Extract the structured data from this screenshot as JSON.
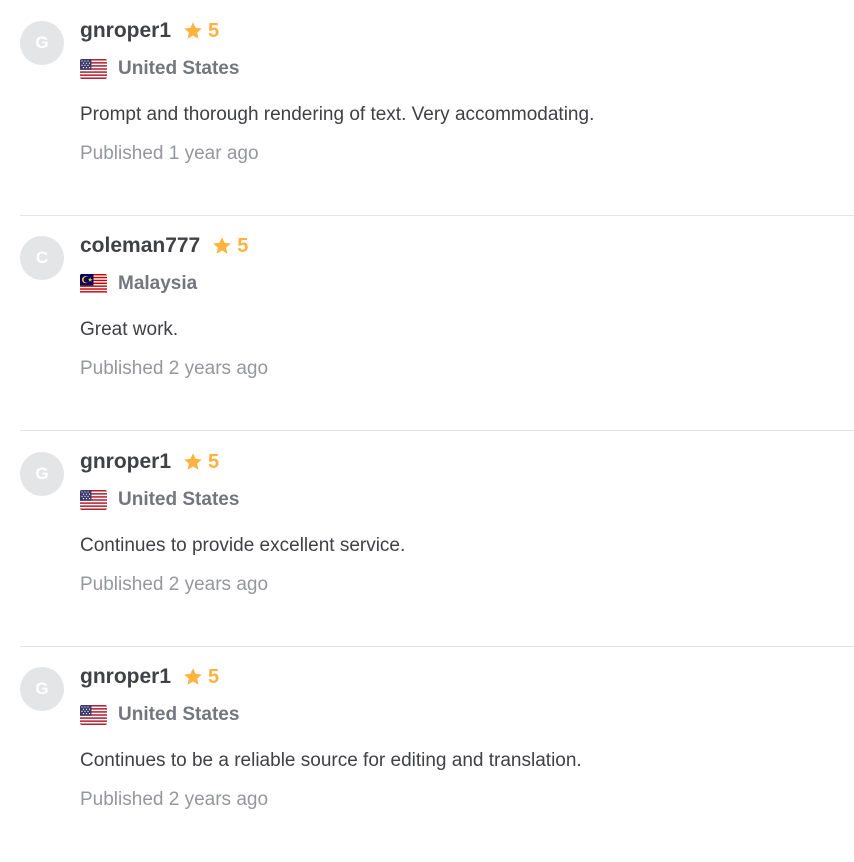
{
  "reviews": [
    {
      "avatar_letter": "G",
      "username": "gnroper1",
      "rating": "5",
      "flag": "us-flag-icon",
      "country": "United States",
      "text": "Prompt and thorough rendering of text. Very accommodating.",
      "published": "Published 1 year ago"
    },
    {
      "avatar_letter": "C",
      "username": "coleman777",
      "rating": "5",
      "flag": "malaysia-flag-icon",
      "country": "Malaysia",
      "text": "Great work.",
      "published": "Published 2 years ago"
    },
    {
      "avatar_letter": "G",
      "username": "gnroper1",
      "rating": "5",
      "flag": "us-flag-icon",
      "country": "United States",
      "text": "Continues to provide excellent service.",
      "published": "Published 2 years ago"
    },
    {
      "avatar_letter": "G",
      "username": "gnroper1",
      "rating": "5",
      "flag": "us-flag-icon",
      "country": "United States",
      "text": "Continues to be a reliable source for editing and translation.",
      "published": "Published 2 years ago"
    }
  ],
  "colors": {
    "star": "#ffb33e",
    "username": "#404145",
    "country": "#74767e",
    "published": "#95979d",
    "avatar_bg": "#e4e5e7",
    "divider": "#e4e5e7"
  }
}
